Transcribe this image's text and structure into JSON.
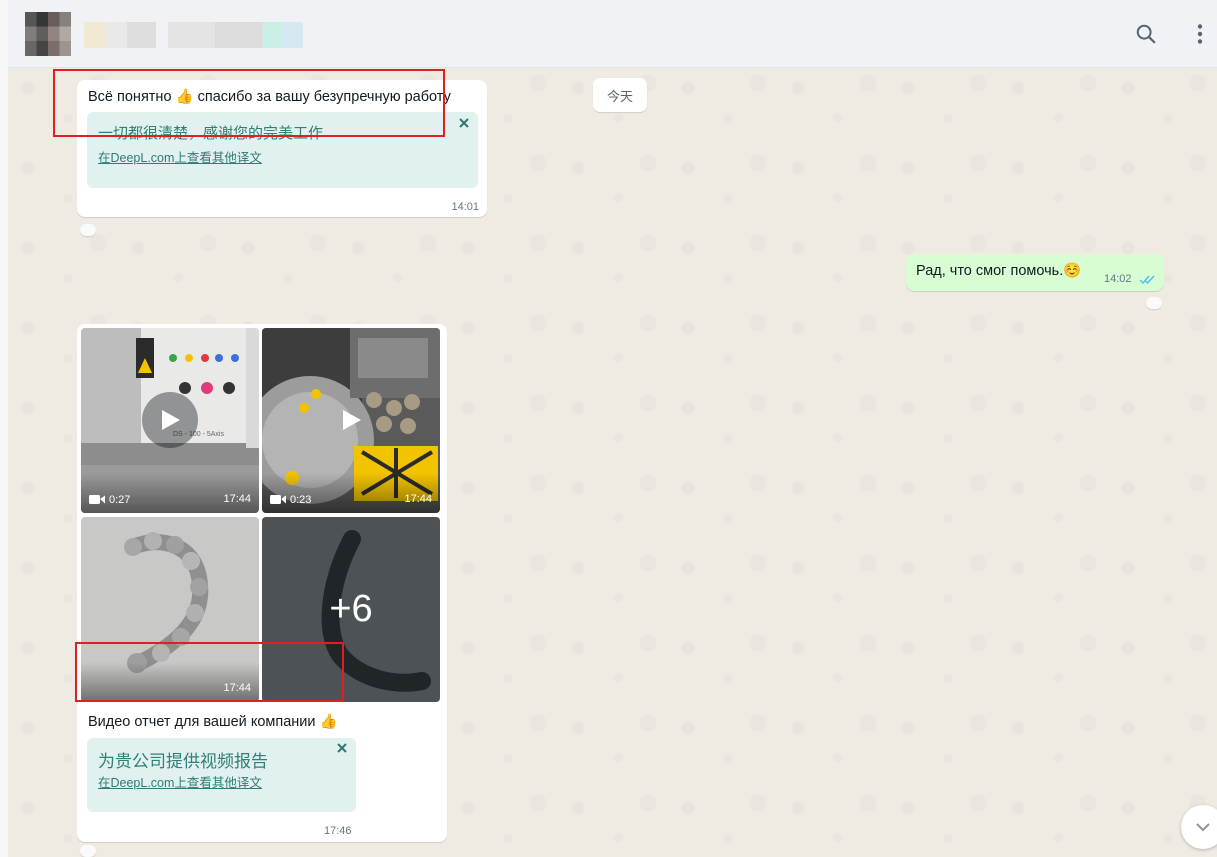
{
  "date_chip": "今天",
  "messages": {
    "m1": {
      "text": "Всё понятно 👍 спасибо за вашу безупречную работу",
      "translation": "一切都很清楚，感谢您的完美工作",
      "link": "在DeepL.com上查看其他译文",
      "time": "14:01"
    },
    "m2": {
      "text": "Рад, что смог помочь.☺️",
      "time": "14:02"
    },
    "m3": {
      "tiles": [
        {
          "kind": "video",
          "duration": "0:27",
          "time": "17:44",
          "machine_label": "DS - 100 - 5Axis"
        },
        {
          "kind": "video",
          "duration": "0:23",
          "time": "17:44"
        },
        {
          "kind": "image",
          "time": "17:44"
        },
        {
          "kind": "image",
          "more": "+6"
        }
      ],
      "caption": "Видео отчет для вашей компании 👍",
      "translation": "为贵公司提供视频报告",
      "link": "在DeepL.com上查看其他译文",
      "time": "17:46"
    }
  },
  "colors": {
    "incoming_bubble": "#ffffff",
    "outgoing_bubble": "#d9fdd3",
    "translation_box": "#e1f1ef",
    "annotation_red": "#e02020",
    "read_ticks": "#53bdeb"
  },
  "icons": [
    "search-icon",
    "menu-dots-icon",
    "close-icon",
    "play-icon",
    "video-camera-icon",
    "read-check-icon",
    "chevron-down-icon"
  ]
}
